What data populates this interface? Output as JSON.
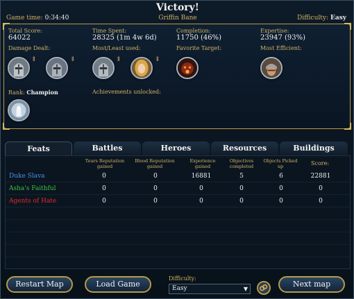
{
  "header": {
    "title": "Victory!",
    "subtitle": "Griffin Bane",
    "game_time_label": "Game time:",
    "game_time_value": "0:34:40",
    "difficulty_label": "Difficulty:",
    "difficulty_value": "Easy"
  },
  "summary": {
    "total_score_label": "Total Score:",
    "total_score_value": "64022",
    "time_spent_label": "Time Spent:",
    "time_spent_value": "28325 (1m 4w 6d)",
    "completion_label": "Completion:",
    "completion_value": "11750 (46%)",
    "expertise_label": "Expertise:",
    "expertise_value": "23947 (93%)",
    "damage_dealt_label": "Damage Dealt:",
    "most_least_used_label": "Most/Least used:",
    "favorite_target_label": "Favorite Target:",
    "most_efficient_label": "Most Efficient:",
    "rank_label": "Rank:",
    "rank_value": "Champion",
    "achievements_label": "Achievements unlocked:",
    "arrow_up": "⇑",
    "arrow_down": "⇓"
  },
  "tabs": [
    {
      "label": "Feats",
      "active": true
    },
    {
      "label": "Battles",
      "active": false
    },
    {
      "label": "Heroes",
      "active": false
    },
    {
      "label": "Resources",
      "active": false
    },
    {
      "label": "Buildings",
      "active": false
    }
  ],
  "table": {
    "columns": [
      "Tears Reputation gained",
      "Blood Reputation gained",
      "Experience gained",
      "Objectives completed",
      "Objects Picked up",
      "Score:"
    ],
    "rows": [
      {
        "name": "Duke Slava",
        "color": "#4f8fe8",
        "values": [
          "0",
          "0",
          "16881",
          "5",
          "6",
          "22881"
        ]
      },
      {
        "name": "Asha's Faithful",
        "color": "#3fc03f",
        "values": [
          "0",
          "0",
          "0",
          "0",
          "0",
          "0"
        ]
      },
      {
        "name": "Agents of Hate",
        "color": "#e02a2a",
        "values": [
          "0",
          "0",
          "0",
          "0",
          "0",
          "0"
        ]
      }
    ]
  },
  "footer": {
    "restart_label": "Restart Map",
    "load_label": "Load Game",
    "difficulty_label": "Difficulty:",
    "difficulty_value": "Easy",
    "next_label": "Next map"
  }
}
